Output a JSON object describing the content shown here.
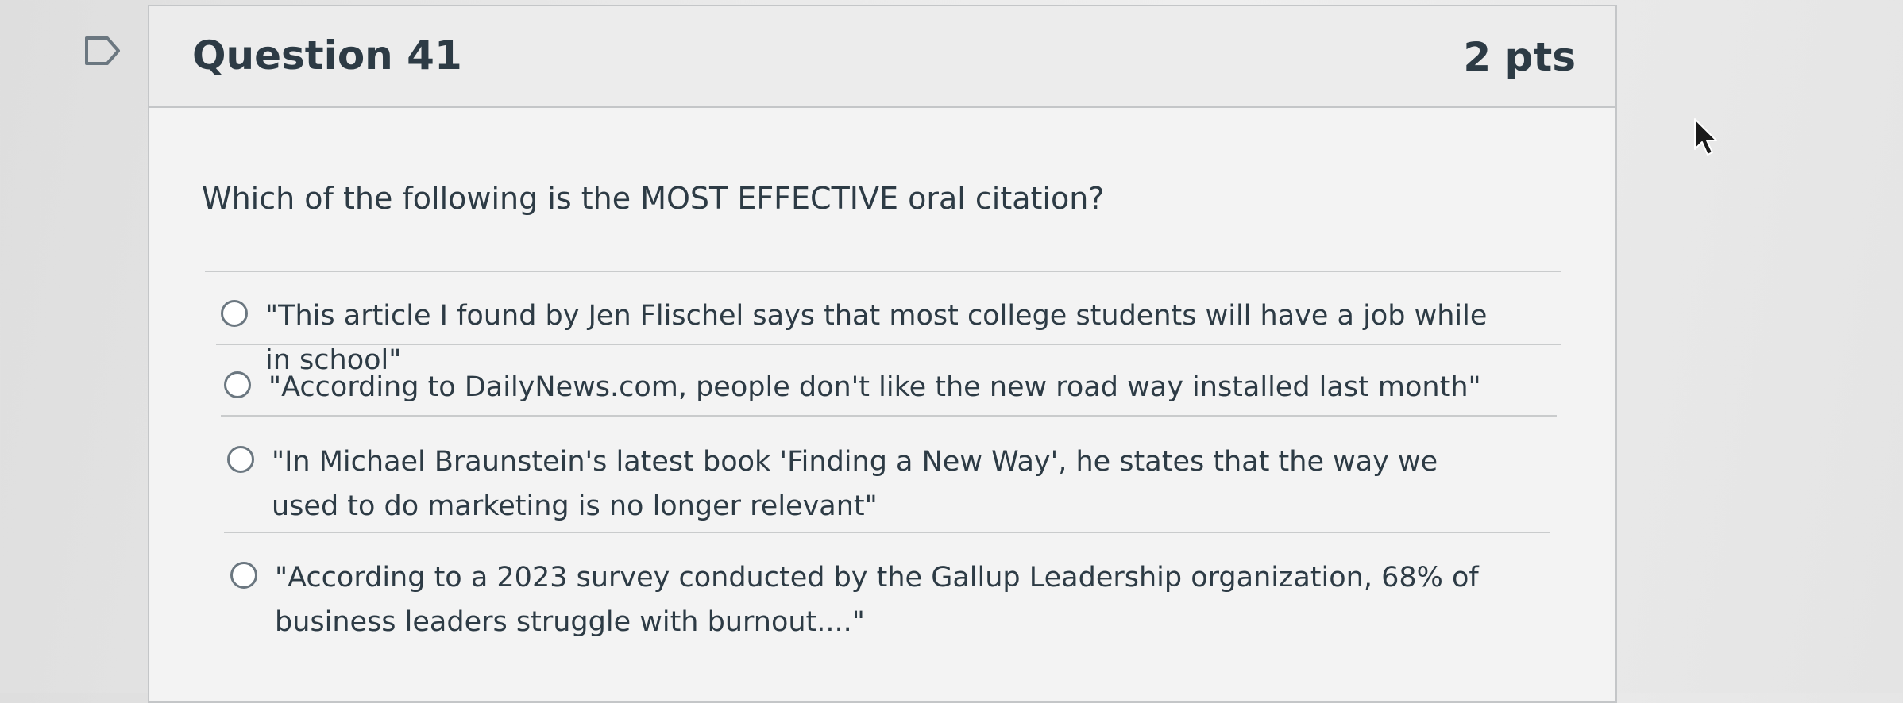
{
  "question": {
    "title": "Question 41",
    "points": "2 pts",
    "text": "Which of the following is the MOST EFFECTIVE oral citation?"
  },
  "answers": [
    {
      "label": "\"This article I found by Jen Flischel says that most college students will have a job while in school\"",
      "selected": false
    },
    {
      "label": "\"According to DailyNews.com, people don't like the new road way installed last month\"",
      "selected": false
    },
    {
      "label": "\"In Michael Braunstein's latest book 'Finding a New Way', he states that the way we used to do marketing is no longer relevant\"",
      "selected": false
    },
    {
      "label": "\"According to a 2023 survey conducted by the Gallup Leadership organization, 68% of business leaders struggle with burnout....\"",
      "selected": false
    }
  ],
  "icons": {
    "flag": "bookmark-flag-icon",
    "cursor": "mouse-pointer-icon"
  },
  "colors": {
    "text": "#2d3b45",
    "border": "#c4c6c8",
    "radio": "#6b7780"
  }
}
